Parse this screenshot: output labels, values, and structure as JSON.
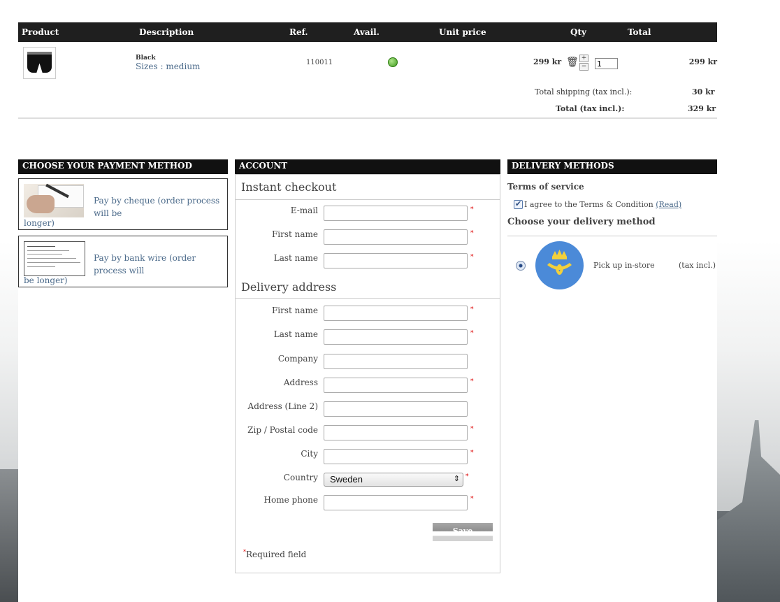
{
  "cart": {
    "headers": {
      "product": "Product",
      "description": "Description",
      "ref": "Ref.",
      "avail": "Avail.",
      "unit_price": "Unit price",
      "qty": "Qty",
      "total": "Total"
    },
    "row": {
      "name": "Black",
      "size": "Sizes : medium",
      "ref": "110011",
      "unit_price": "299 kr",
      "qty": "1",
      "total": "299 kr",
      "avail_color": "#4caf2a"
    },
    "shipping_label": "Total shipping (tax incl.):",
    "shipping_value": "30 kr",
    "total_label": "Total (tax incl.):",
    "total_value": "329 kr"
  },
  "payment": {
    "title": "CHOOSE YOUR PAYMENT METHOD",
    "cheque_line1": "Pay by cheque (order process will be",
    "cheque_line2": "longer)",
    "wire_line1": "Pay by bank wire (order process will",
    "wire_line2": "be longer)"
  },
  "account": {
    "title": "ACCOUNT",
    "instant_checkout": "Instant checkout",
    "email_label": "E-mail",
    "firstname_label": "First name",
    "lastname_label": "Last name",
    "delivery_address": "Delivery address",
    "d_firstname_label": "First name",
    "d_lastname_label": "Last name",
    "company_label": "Company",
    "address_label": "Address",
    "address2_label": "Address (Line 2)",
    "zip_label": "Zip / Postal code",
    "city_label": "City",
    "country_label": "Country",
    "country_value": "Sweden",
    "phone_label": "Home phone",
    "save_label": "Save",
    "required_note": "Required field",
    "required_mark": "*"
  },
  "delivery": {
    "title": "DELIVERY METHODS",
    "tos_title": "Terms of service",
    "agree_text": "I agree to the Terms & Condition",
    "read_link": "(Read)",
    "choose_title": "Choose your delivery method",
    "pickup": "Pick up in-store",
    "tax_incl": "(tax incl.)",
    "logo_color": "#4b8ad8"
  }
}
